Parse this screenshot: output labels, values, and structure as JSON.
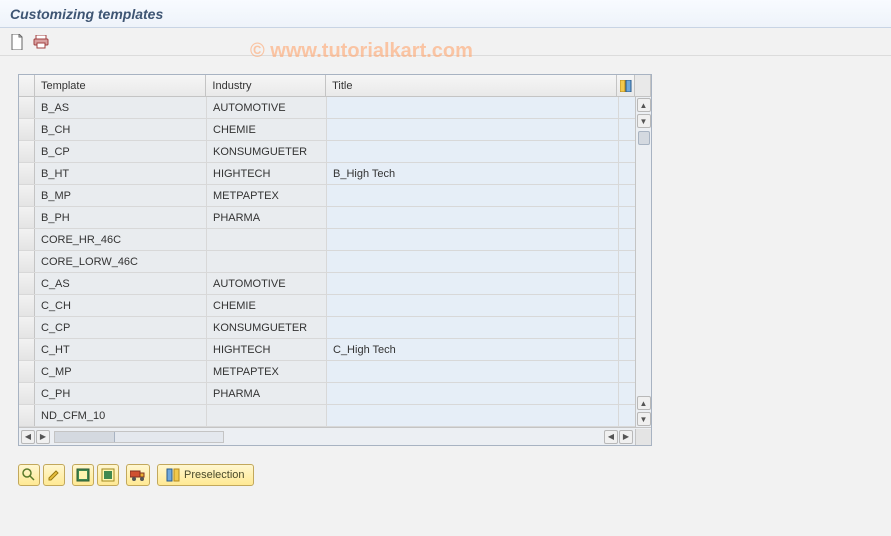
{
  "page_title": "Customizing templates",
  "watermark": "© www.tutorialkart.com",
  "columns": {
    "template": "Template",
    "industry": "Industry",
    "title": "Title"
  },
  "rows": [
    {
      "template": "B_AS",
      "industry": "AUTOMOTIVE",
      "title": ""
    },
    {
      "template": "B_CH",
      "industry": "CHEMIE",
      "title": ""
    },
    {
      "template": "B_CP",
      "industry": "KONSUMGUETER",
      "title": ""
    },
    {
      "template": "B_HT",
      "industry": "HIGHTECH",
      "title": "B_High Tech"
    },
    {
      "template": "B_MP",
      "industry": "METPAPTEX",
      "title": ""
    },
    {
      "template": "B_PH",
      "industry": "PHARMA",
      "title": ""
    },
    {
      "template": "CORE_HR_46C",
      "industry": "",
      "title": ""
    },
    {
      "template": "CORE_LORW_46C",
      "industry": "",
      "title": ""
    },
    {
      "template": "C_AS",
      "industry": "AUTOMOTIVE",
      "title": ""
    },
    {
      "template": "C_CH",
      "industry": "CHEMIE",
      "title": ""
    },
    {
      "template": "C_CP",
      "industry": "KONSUMGUETER",
      "title": ""
    },
    {
      "template": "C_HT",
      "industry": "HIGHTECH",
      "title": "C_High Tech"
    },
    {
      "template": "C_MP",
      "industry": "METPAPTEX",
      "title": ""
    },
    {
      "template": "C_PH",
      "industry": "PHARMA",
      "title": ""
    },
    {
      "template": "ND_CFM_10",
      "industry": "",
      "title": ""
    }
  ],
  "actions": {
    "preselection": "Preselection"
  }
}
